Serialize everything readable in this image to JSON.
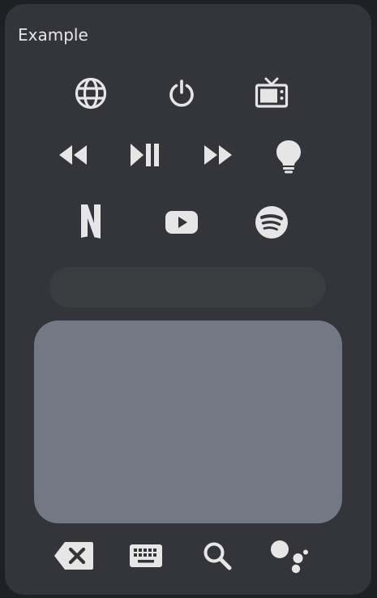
{
  "card": {
    "title": "Example"
  },
  "icons": {
    "row1": [
      "globe-icon",
      "power-icon",
      "tv-icon"
    ],
    "row2": [
      "rewind-icon",
      "play-pause-icon",
      "fast-forward-icon",
      "lightbulb-icon"
    ],
    "row3": [
      "netflix-icon",
      "youtube-icon",
      "spotify-icon"
    ],
    "bottom": [
      "backspace-icon",
      "keyboard-icon",
      "search-icon",
      "google-assistant-icon"
    ]
  },
  "colors": {
    "background": "#1f2023",
    "card": "#34353b",
    "icon": "#e6e6e6",
    "pill": "#3b3c40",
    "touchpad": "#727984"
  }
}
